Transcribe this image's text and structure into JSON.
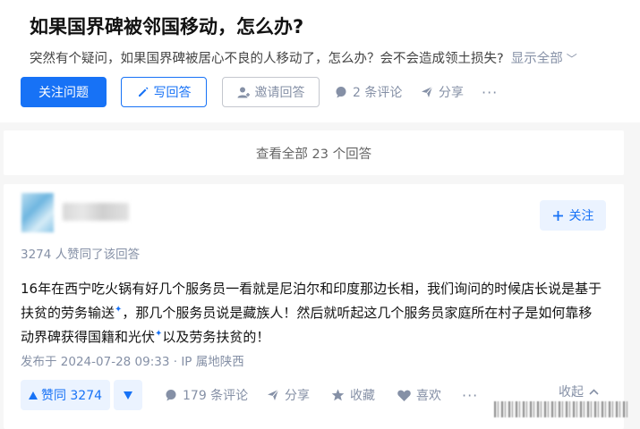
{
  "question": {
    "title": "如果国界碑被邻国移动，怎么办?",
    "description": "突然有个疑问，如果国界碑被居心不良的人移动了，怎么办？会不会造成领土损失?",
    "show_all": "显示全部"
  },
  "question_actions": {
    "follow": "关注问题",
    "answer": "写回答",
    "invite": "邀请回答",
    "comments": "2 条评论",
    "share": "分享",
    "more": "···"
  },
  "view_all_answers": "查看全部 23 个回答",
  "answer": {
    "follow": "关注",
    "votes_summary": "3274 人赞同了该回答",
    "body": {
      "part1": "16年在西宁吃火锅有好几个服务员一看就是尼泊尔和印度那边长相，我们询问的时候店长说是基于",
      "link1": "扶贫的劳务输送",
      "part2": "，那几个服务员说是藏族人！然后就听起这几个服务员家庭所在村子是如何靠移",
      "part3": "动界碑获得国籍和",
      "link2": "光伏",
      "part4": "以及劳务扶贫的！"
    },
    "published": "发布于 2024-07-28 09:33 · IP 属地陕西",
    "upvote": "赞同 3274",
    "comments": "179 条评论",
    "share": "分享",
    "collect": "收藏",
    "like": "喜欢",
    "more": "···",
    "collapse": "收起"
  },
  "colors": {
    "accent": "#1772f6",
    "muted": "#8590a6",
    "light_blue_bg": "#ebf3ff"
  }
}
